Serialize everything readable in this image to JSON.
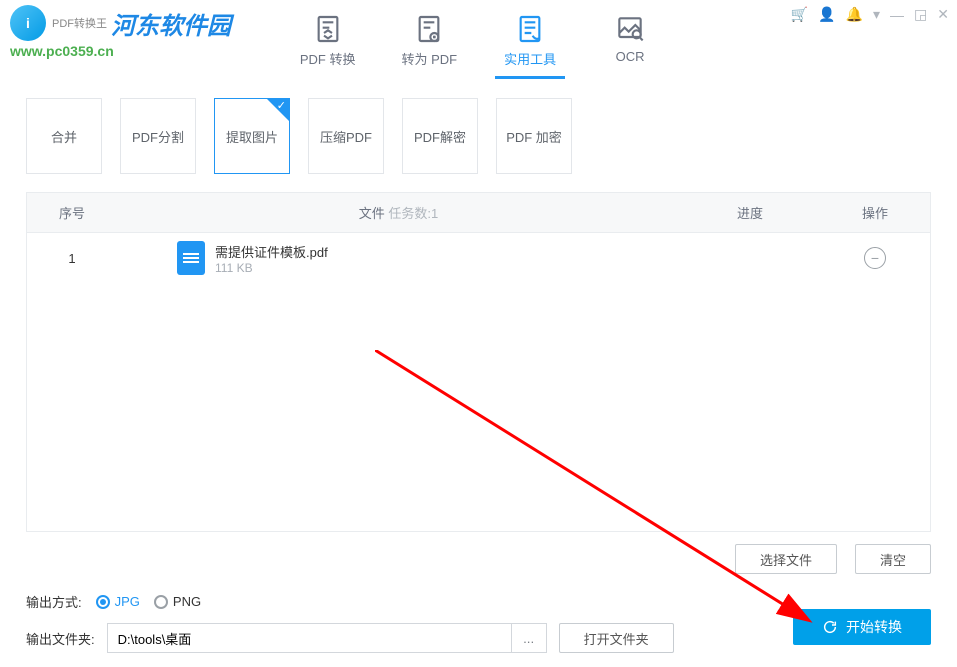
{
  "app": {
    "title": "PDF转换王",
    "logo_text": "河东软件园",
    "logo_url": "www.pc0359.cn"
  },
  "nav": {
    "items": [
      {
        "label": "PDF 转换"
      },
      {
        "label": "转为 PDF"
      },
      {
        "label": "实用工具"
      },
      {
        "label": "OCR"
      }
    ]
  },
  "tools": {
    "items": [
      {
        "label": "合并"
      },
      {
        "label": "PDF分割"
      },
      {
        "label": "提取图片"
      },
      {
        "label": "压缩PDF"
      },
      {
        "label": "PDF解密"
      },
      {
        "label": "PDF 加密"
      }
    ]
  },
  "table": {
    "headers": {
      "seq": "序号",
      "file": "文件",
      "task_label": "任务数:",
      "task_count": "1",
      "progress": "进度",
      "op": "操作"
    },
    "rows": [
      {
        "seq": "1",
        "name": "需提供证件模板.pdf",
        "size": "111 KB"
      }
    ]
  },
  "actions": {
    "choose": "选择文件",
    "clear": "清空"
  },
  "output": {
    "format_label": "输出方式:",
    "jpg": "JPG",
    "png": "PNG",
    "folder_label": "输出文件夹:",
    "path": "D:\\tools\\桌面",
    "browse": "...",
    "open": "打开文件夹",
    "start": "开始转换"
  }
}
